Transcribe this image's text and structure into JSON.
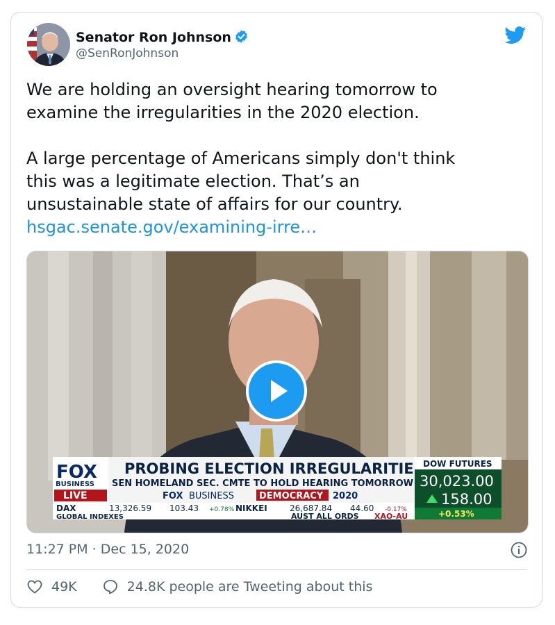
{
  "author": {
    "name": "Senator Ron Johnson",
    "handle": "@SenRonJohnson",
    "avatar_icon": "senator-portrait",
    "verified_icon": "verified-badge-icon"
  },
  "tweet": {
    "paragraph1": "We are holding an oversight hearing tomorrow to\nexamine the irregularities in the 2020 election.",
    "paragraph2": "A large percentage of Americans simply don't think\nthis was a legitimate election. That’s an\nunsustainable state of affairs for our country.",
    "link": "hsgac.senate.gov/examining-irre…"
  },
  "video": {
    "logo_top": "FOX",
    "logo_bottom": "BUSINESS",
    "live": "LIVE",
    "headline": "PROBING ELECTION IRREGULARITIES",
    "subheadline": "SEN HOMELAND SEC. CMTE TO HOLD HEARING TOMORROW",
    "brand_line_fox": "FOX",
    "brand_line_business": "BUSINESS",
    "brand_line_democracy": "DEMOCRACY",
    "brand_line_year": "2020",
    "dow_label": "DOW FUTURES",
    "dow_value": "30,023.00",
    "dow_change": "158.00",
    "dow_pct": "+0.53%",
    "ticker_dax": "DAX",
    "ticker_dax_value": "13,326.59",
    "ticker_dax_change": "103.43",
    "ticker_dax_pct": "+0.78%",
    "ticker_nikkei": "NIKKEI",
    "ticker_nikkei_value": "26,687.84",
    "ticker_nikkei_change": "44.60",
    "ticker_nikkei_pct": "-0.17%",
    "global_indexes": "GLOBAL INDEXES",
    "aust_all_ords": "AUST ALL ORDS",
    "xao": "XAO-AU"
  },
  "meta": {
    "timestamp": "11:27 PM · Dec 15, 2020"
  },
  "actions": {
    "likes": "49K",
    "conversation": "24.8K people are Tweeting about this"
  },
  "colors": {
    "twitter_blue": "#1d9bf0",
    "link_blue": "#1b95e0",
    "secondary_text": "#536471"
  }
}
